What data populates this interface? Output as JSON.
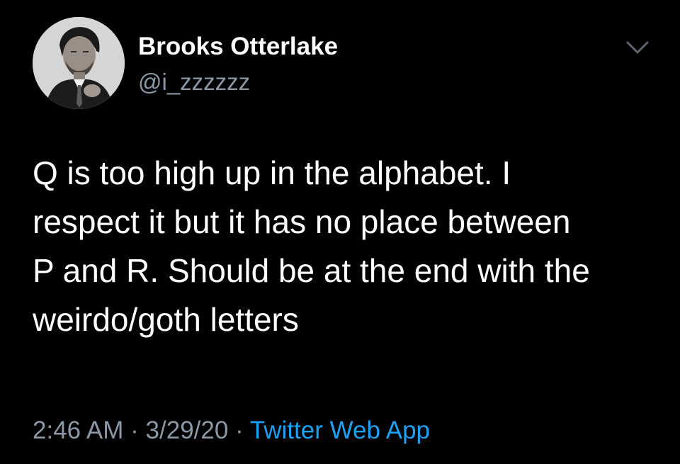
{
  "tweet": {
    "author": {
      "display_name": "Brooks Otterlake",
      "handle": "@i_zzzzzz",
      "avatar_icon": "user-avatar-photo"
    },
    "menu_icon": "chevron-down-icon",
    "text": "Q is too high up in the alphabet. I\nrespect it but it has no place between\nP and R. Should be at the end with the\nweirdo/goth letters",
    "time": "2:46 AM",
    "separator": "·",
    "date": "3/29/20",
    "source": "Twitter Web App"
  },
  "colors": {
    "background": "#000000",
    "primary_text": "#ffffff",
    "secondary_text": "#8b98a5",
    "link": "#1da1f2"
  }
}
